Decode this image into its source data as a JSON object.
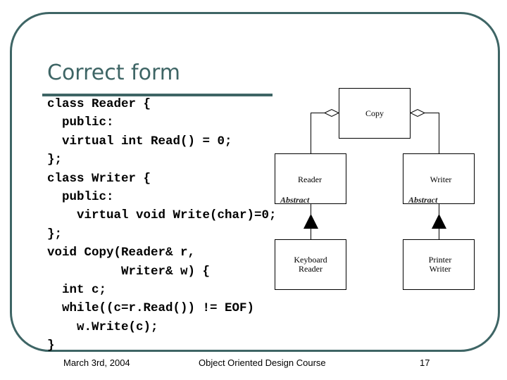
{
  "slide": {
    "title": "Correct form",
    "code_lines": [
      "class Reader {",
      "  public:",
      "  virtual int Read() = 0;",
      "};",
      "class Writer {",
      "  public:",
      "    virtual void Write(char)=0;",
      "};",
      "void Copy(Reader& r,",
      "          Writer& w) {",
      "  int c;",
      "  while((c=r.Read()) != EOF)",
      "    w.Write(c);",
      "}"
    ],
    "frame_color": "#3e6565"
  },
  "diagram": {
    "classes": {
      "copy": {
        "label_lines": [
          "Copy"
        ]
      },
      "reader": {
        "label_lines": [
          "Reader"
        ],
        "stereotype": "Abstract"
      },
      "writer": {
        "label_lines": [
          "Writer"
        ],
        "stereotype": "Abstract"
      },
      "keyboard_reader": {
        "label_lines": [
          "Keyboard",
          "Reader"
        ]
      },
      "printer_writer": {
        "label_lines": [
          "Printer",
          "Writer"
        ]
      }
    },
    "relations": [
      {
        "type": "aggregation",
        "from": "copy",
        "to": "reader"
      },
      {
        "type": "aggregation",
        "from": "copy",
        "to": "writer"
      },
      {
        "type": "inheritance",
        "from": "keyboard_reader",
        "to": "reader"
      },
      {
        "type": "inheritance",
        "from": "printer_writer",
        "to": "writer"
      }
    ]
  },
  "footer": {
    "date": "March 3rd, 2004",
    "course": "Object Oriented Design Course",
    "page_number": "17"
  }
}
